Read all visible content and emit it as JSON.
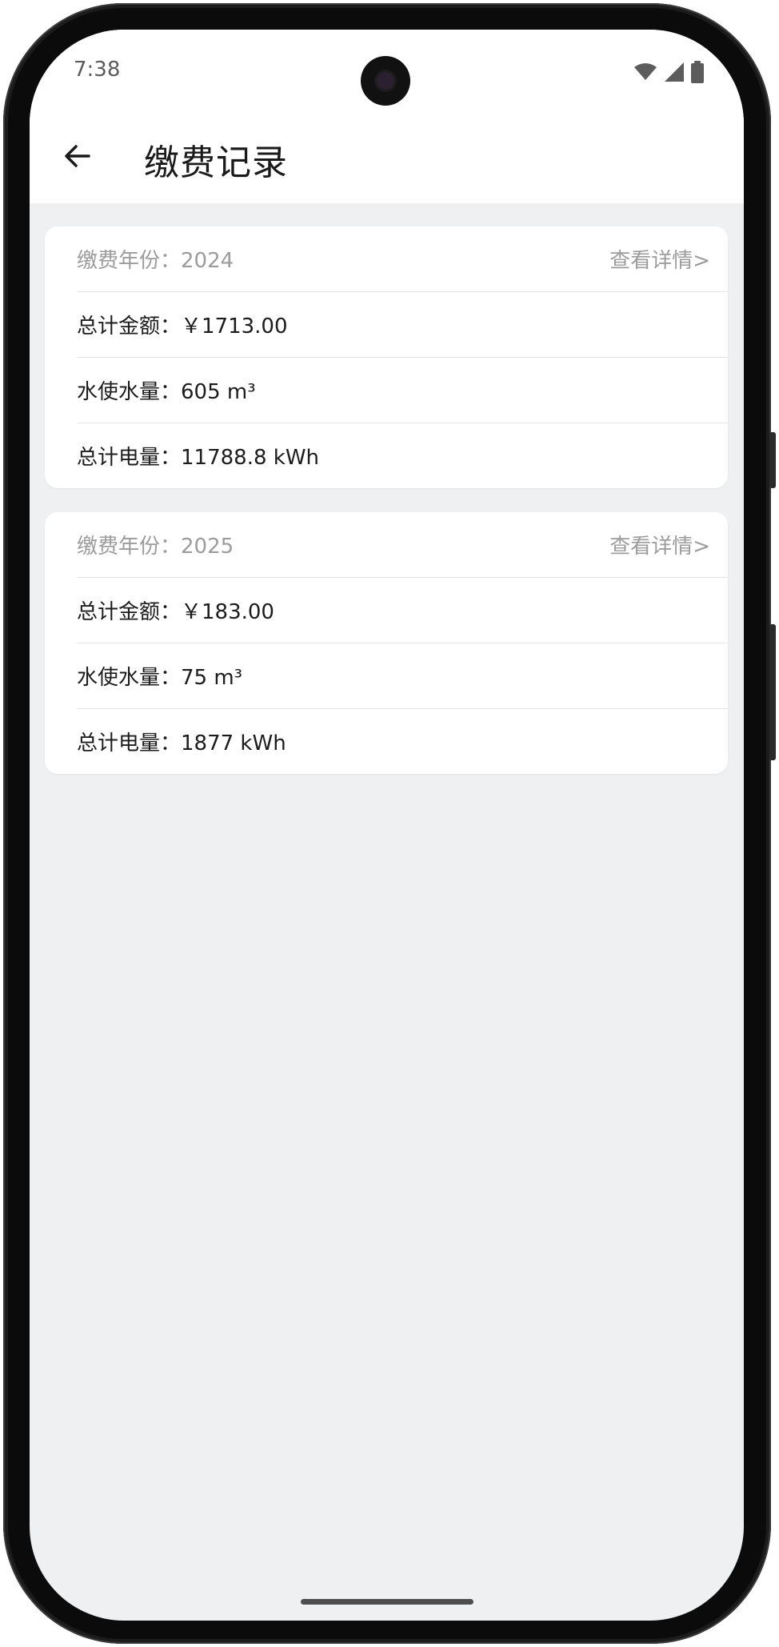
{
  "status_bar": {
    "time": "7:38",
    "icons": [
      "wifi-icon",
      "cell-signal-icon",
      "battery-icon"
    ]
  },
  "header": {
    "back_icon": "arrow-left-icon",
    "title": "缴费记录"
  },
  "records": [
    {
      "year_label": "缴费年份：2024",
      "detail_link": "查看详情>",
      "total_amount": "总计金额：￥1713.00",
      "water_usage": "水使水量：605 m³",
      "electricity_usage": "总计电量：11788.8 kWh"
    },
    {
      "year_label": "缴费年份：2025",
      "detail_link": "查看详情>",
      "total_amount": "总计金额：￥183.00",
      "water_usage": "水使水量：75 m³",
      "electricity_usage": "总计电量：1877 kWh"
    }
  ],
  "colors": {
    "page_background": "#eff0f2",
    "card_background": "#ffffff",
    "muted_text": "#9c9c9c",
    "primary_text": "#1c1c1c"
  }
}
